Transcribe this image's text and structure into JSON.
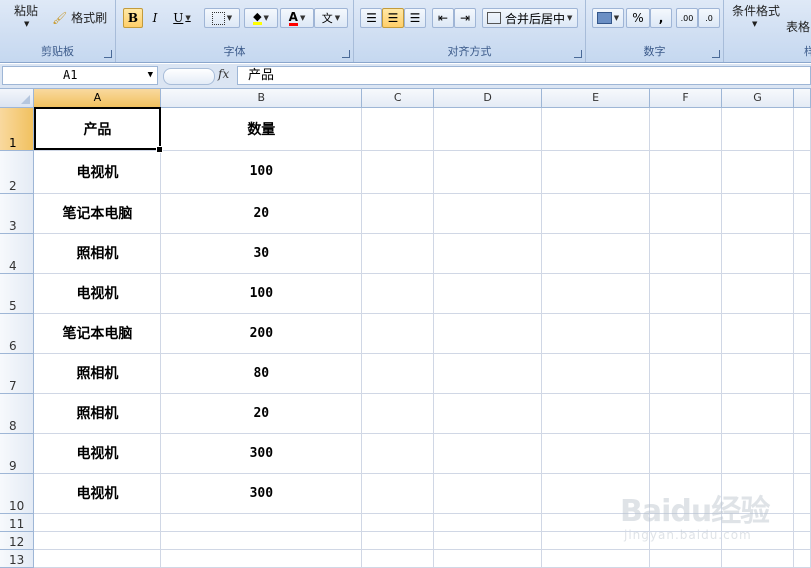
{
  "ribbon": {
    "clipboard": {
      "label": "剪贴板",
      "paste": "粘贴",
      "format_painter": "格式刷"
    },
    "font": {
      "label": "字体",
      "bold": "B",
      "italic": "I",
      "underline": "U",
      "fill_glyph": "A",
      "color_glyph": "A",
      "phonetic": "文"
    },
    "alignment": {
      "label": "对齐方式",
      "merge": "合并后居中"
    },
    "number": {
      "label": "数字",
      "percent": "%",
      "comma": ",",
      "inc_decimal": ".00",
      "dec_decimal": ".0"
    },
    "styles": {
      "cond_format": "条件格式",
      "table_format_partial": "表格",
      "label_partial": "样"
    },
    "colors": {
      "fill": "#ffff00",
      "font": "#ff0000"
    }
  },
  "formula_bar": {
    "name_box": "A1",
    "fx": "fx",
    "content": "产品"
  },
  "grid": {
    "columns": [
      "A",
      "B",
      "C",
      "D",
      "E",
      "F",
      "G"
    ],
    "rows": [
      {
        "n": "1",
        "a": "产品",
        "b": "数量"
      },
      {
        "n": "2",
        "a": "电视机",
        "b": "100"
      },
      {
        "n": "3",
        "a": "笔记本电脑",
        "b": "20"
      },
      {
        "n": "4",
        "a": "照相机",
        "b": "30"
      },
      {
        "n": "5",
        "a": "电视机",
        "b": "100"
      },
      {
        "n": "6",
        "a": "笔记本电脑",
        "b": "200"
      },
      {
        "n": "7",
        "a": "照相机",
        "b": "80"
      },
      {
        "n": "8",
        "a": "照相机",
        "b": "20"
      },
      {
        "n": "9",
        "a": "电视机",
        "b": "300"
      },
      {
        "n": "10",
        "a": "电视机",
        "b": "300"
      },
      {
        "n": "11",
        "a": "",
        "b": ""
      },
      {
        "n": "12",
        "a": "",
        "b": ""
      },
      {
        "n": "13",
        "a": "",
        "b": ""
      }
    ]
  },
  "watermark": {
    "logo": "Baidu经验",
    "url": "jingyan.baidu.com"
  }
}
